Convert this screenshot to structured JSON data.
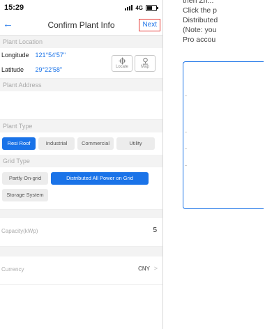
{
  "status_bar": {
    "time": "15:29",
    "network": "4G",
    "battery_level": 0.55
  },
  "nav": {
    "back_icon": "back-arrow-icon",
    "title": "Confirm Plant Info",
    "next_label": "Next"
  },
  "location": {
    "section_title": "Plant Location",
    "longitude_label": "Longitude",
    "longitude_value": "121°54'57\"",
    "latitude_label": "Latitude",
    "latitude_value": "29°22'58\"",
    "locate_label": "Locate",
    "map_label": "Map"
  },
  "address": {
    "section_title": "Plant Address",
    "value": ""
  },
  "plant_type": {
    "section_title": "Plant Type",
    "options": [
      "Resi Roof",
      "Industrial",
      "Commercial",
      "Utility"
    ],
    "selected": "Resi Roof"
  },
  "grid_type": {
    "section_title": "Grid Type",
    "options": [
      "Partly On-grid",
      "Distributed All Power on Grid",
      "Storage System"
    ],
    "selected": "Distributed All Power on Grid"
  },
  "capacity": {
    "label": "Capacity(kWp)",
    "value": "5"
  },
  "currency": {
    "label": "Currency",
    "value": "CNY"
  },
  "side_text": {
    "line1": "then Zh...",
    "line2": "Click the p",
    "line3": "Distributed",
    "line4": "(Note: you",
    "line5": "Pro accou"
  },
  "colors": {
    "accent": "#1a73e8",
    "highlight_border": "#e53935"
  }
}
